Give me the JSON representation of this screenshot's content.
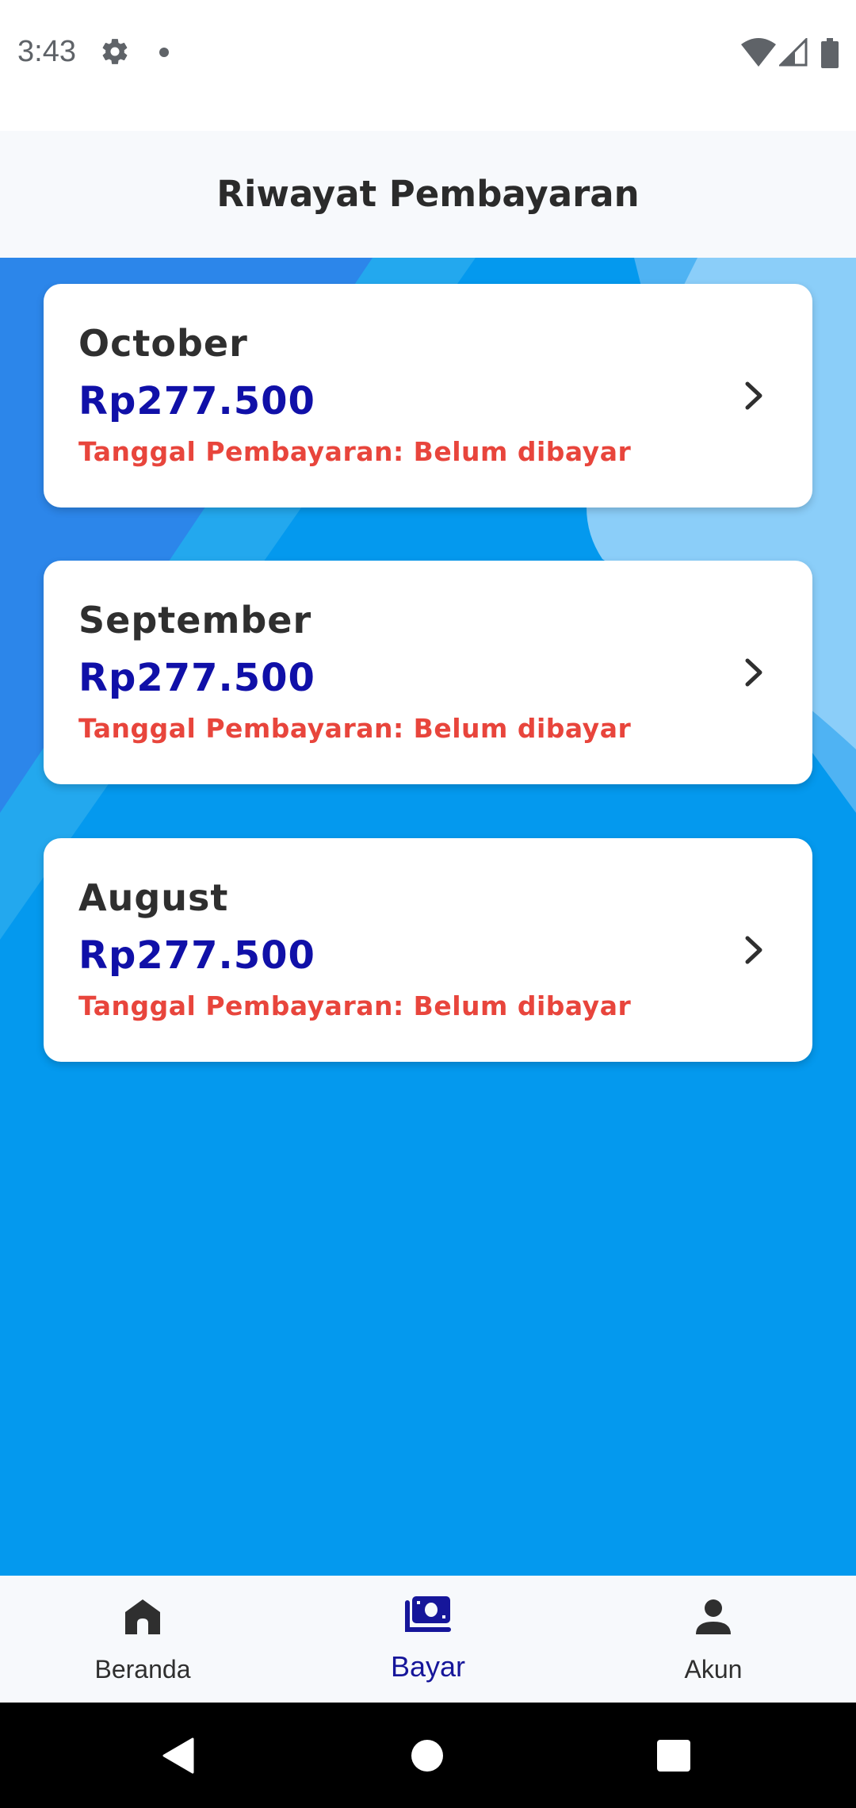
{
  "status_bar": {
    "time": "3:43",
    "icons": [
      "gear-icon",
      "dot-icon",
      "wifi-icon",
      "signal-icon",
      "battery-icon"
    ]
  },
  "app_bar": {
    "title": "Riwayat Pembayaran"
  },
  "payments": [
    {
      "month": "October",
      "amount": "Rp277.500",
      "date_status": "Tanggal Pembayaran: Belum dibayar"
    },
    {
      "month": "September",
      "amount": "Rp277.500",
      "date_status": "Tanggal Pembayaran: Belum dibayar"
    },
    {
      "month": "August",
      "amount": "Rp277.500",
      "date_status": "Tanggal Pembayaran: Belum dibayar"
    }
  ],
  "bottom_nav": {
    "items": [
      {
        "label": "Beranda",
        "icon": "home-icon",
        "active": false
      },
      {
        "label": "Bayar",
        "icon": "payment-icon",
        "active": true
      },
      {
        "label": "Akun",
        "icon": "person-icon",
        "active": false
      }
    ]
  },
  "system_nav": {
    "icons": [
      "back-icon",
      "home-circle-icon",
      "recents-icon"
    ]
  },
  "colors": {
    "background_blue": "#0499ee",
    "amount": "#1010a8",
    "unpaid_status": "#e8453c",
    "active_nav": "#16169a"
  }
}
